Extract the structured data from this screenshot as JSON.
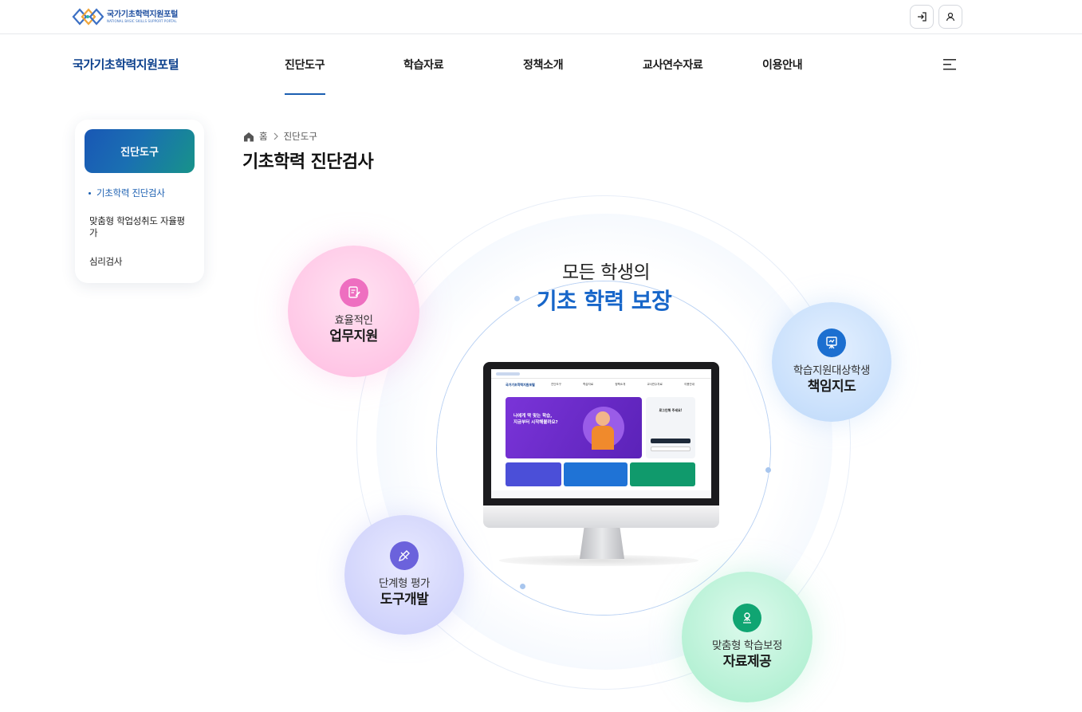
{
  "header": {
    "logo_ko": "국가기초학력지원포털",
    "logo_en": "NATIONAL BASIC SKILLS SUPPORT PORTAL",
    "login_icon": "login-icon",
    "user_icon": "user-icon"
  },
  "nav": {
    "site_title": "국가기초학력지원포털",
    "items": [
      {
        "label": "진단도구",
        "active": true
      },
      {
        "label": "학습자료"
      },
      {
        "label": "정책소개"
      },
      {
        "label": "교사연수자료"
      },
      {
        "label": "이용안내"
      }
    ],
    "menu_icon": "hamburger-menu-icon",
    "accent": "#1b5fb1"
  },
  "sidebar": {
    "heading": "진단도구",
    "items": [
      {
        "label": "기초학력 진단검사",
        "active": true
      },
      {
        "label": "맞춤형 학업성취도 자율평가"
      },
      {
        "label": "심리검사"
      }
    ]
  },
  "breadcrumb": {
    "home": "홈",
    "current": "진단도구"
  },
  "page": {
    "title": "기초학력 진단검사"
  },
  "hero": {
    "line1": "모든 학생의",
    "line2": "기초 학력 보장",
    "features": [
      {
        "sub": "효율적인",
        "main": "업무지원",
        "icon": "document-edit-icon",
        "color": "#ee6fc0"
      },
      {
        "sub": "학습지원대상학생",
        "main": "책임지도",
        "icon": "presentation-board-icon",
        "color": "#1c6fd0"
      },
      {
        "sub": "단계형 평가",
        "main": "도구개발",
        "icon": "pencil-ruler-icon",
        "color": "#6b62dc"
      },
      {
        "sub": "맞춤형 학습보정",
        "main": "자료제공",
        "icon": "location-pin-icon",
        "color": "#10a572"
      }
    ]
  },
  "mockup": {
    "site_title": "국가기초학력지원포털",
    "menu": [
      "진단도구",
      "학습자료",
      "정책소개",
      "교사연수자료",
      "이용안내"
    ],
    "banner_line1": "나에게 딱 맞는 학습,",
    "banner_line2": "지금부터 시작해볼까요?",
    "login_prompt": "로그인해 주세요!"
  }
}
